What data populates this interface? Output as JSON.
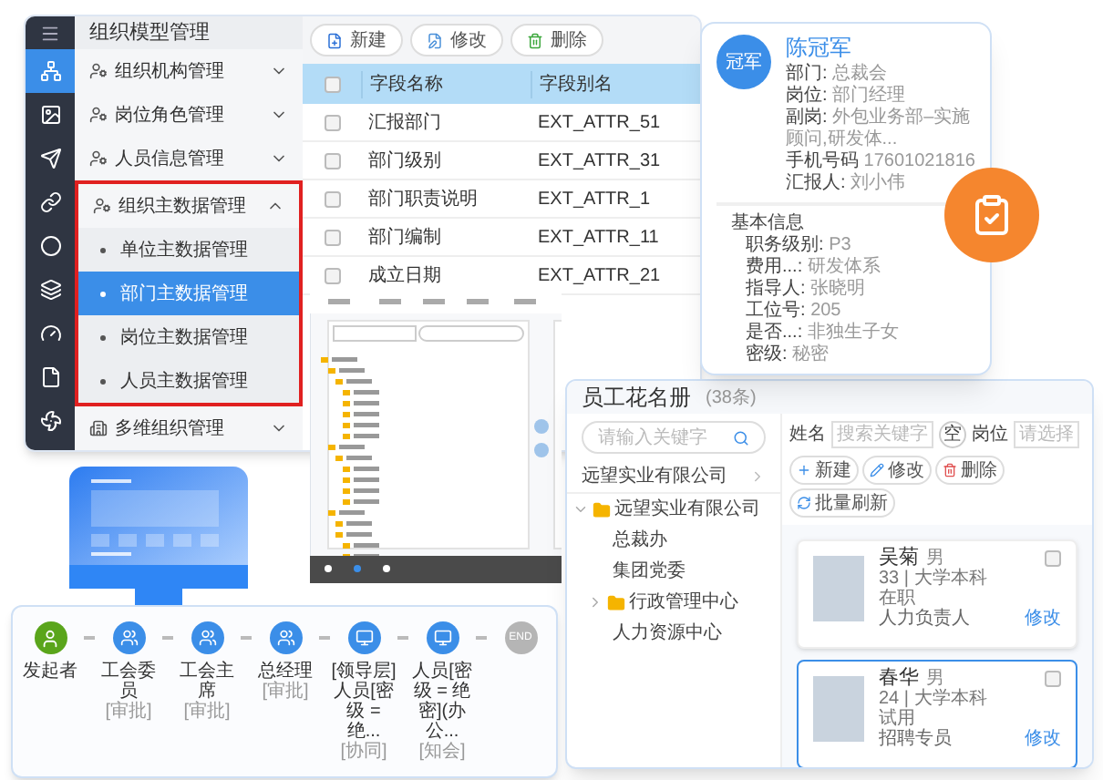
{
  "sidebar": {
    "icons": [
      {
        "kind": "sitemap",
        "selected": true
      },
      {
        "kind": "image",
        "selected": false
      },
      {
        "kind": "send",
        "selected": false
      },
      {
        "kind": "link",
        "selected": false
      },
      {
        "kind": "circle",
        "selected": false
      },
      {
        "kind": "layers",
        "selected": false
      },
      {
        "kind": "gauge",
        "selected": false
      },
      {
        "kind": "file",
        "selected": false
      },
      {
        "kind": "fan",
        "selected": false
      }
    ]
  },
  "menu": {
    "title": "组织模型管理",
    "items": [
      {
        "label": "组织机构管理",
        "kind": "user",
        "expanded": false,
        "highlighted": false
      },
      {
        "label": "岗位角色管理",
        "kind": "user",
        "expanded": false,
        "highlighted": false
      },
      {
        "label": "人员信息管理",
        "kind": "user",
        "expanded": false,
        "highlighted": false
      },
      {
        "label": "组织主数据管理",
        "kind": "user",
        "expanded": true,
        "highlighted": true,
        "children": [
          {
            "label": "单位主数据管理",
            "selected": false
          },
          {
            "label": "部门主数据管理",
            "selected": true
          },
          {
            "label": "岗位主数据管理",
            "selected": false
          },
          {
            "label": "人员主数据管理",
            "selected": false
          }
        ]
      },
      {
        "label": "多维组织管理",
        "kind": "building",
        "expanded": false,
        "highlighted": false
      }
    ]
  },
  "toolbar": [
    {
      "label": "新建",
      "kind": "new"
    },
    {
      "label": "修改",
      "kind": "edit"
    },
    {
      "label": "删除",
      "kind": "delete"
    }
  ],
  "table": {
    "columns": [
      "字段名称",
      "字段别名"
    ],
    "header_checked": false,
    "rows": [
      {
        "cells": [
          "汇报部门",
          "EXT_ATTR_51"
        ],
        "checked": false
      },
      {
        "cells": [
          "部门级别",
          "EXT_ATTR_31"
        ],
        "checked": false
      },
      {
        "cells": [
          "部门职责说明",
          "EXT_ATTR_1"
        ],
        "checked": false
      },
      {
        "cells": [
          "部门编制",
          "EXT_ATTR_11"
        ],
        "checked": false
      },
      {
        "cells": [
          "成立日期",
          "EXT_ATTR_21"
        ],
        "checked": false
      }
    ]
  },
  "profile": {
    "avatar": "冠军",
    "name": "陈冠军",
    "fields": [
      {
        "label": "部门:",
        "value": "总裁会"
      },
      {
        "label": "岗位:",
        "value": "部门经理"
      },
      {
        "label": "副岗:",
        "value": "外包业务部–实施顾问,研发体..."
      },
      {
        "label": "手机号码",
        "value": "17601021816"
      },
      {
        "label": "汇报人:",
        "value": "刘小伟"
      }
    ],
    "section": "基本信息",
    "details": [
      {
        "label": "职务级别:",
        "value": "P3"
      },
      {
        "label": "费用...:",
        "value": "研发体系"
      },
      {
        "label": "指导人:",
        "value": "张晓明"
      },
      {
        "label": "工位号:",
        "value": "205"
      },
      {
        "label": "是否...:",
        "value": "非独生子女"
      },
      {
        "label": "密级:",
        "value": "秘密"
      }
    ]
  },
  "roster": {
    "title": "员工花名册",
    "count": "(38条)",
    "search_placeholder": "请输入关键字",
    "company": "远望实业有限公司",
    "tree": [
      {
        "label": "远望实业有限公司",
        "folder": true,
        "expanded": true,
        "children": [
          {
            "label": "总裁办",
            "folder": false
          },
          {
            "label": "集团党委",
            "folder": false
          },
          {
            "label": "行政管理中心",
            "folder": true,
            "expanded": false
          },
          {
            "label": "人力资源中心",
            "folder": false
          }
        ]
      }
    ],
    "filters": [
      {
        "label": "姓名",
        "placeholder": "搜索关键字"
      },
      {
        "label": "岗位",
        "placeholder": "请选择"
      }
    ],
    "clear": "空",
    "buttons": [
      {
        "label": "新建",
        "kind": "add"
      },
      {
        "label": "修改",
        "kind": "edit"
      },
      {
        "label": "删除",
        "kind": "delete"
      },
      {
        "label": "批量刷新",
        "kind": "refresh"
      }
    ],
    "cards": [
      {
        "name": "吴菊",
        "gender": "男",
        "info": "33 | 大学本科",
        "status": "在职",
        "role": "人力负责人",
        "action": "修改",
        "selected": false,
        "checked": false
      },
      {
        "name": "春华",
        "gender": "男",
        "info": "24 | 大学本科",
        "status": "试用",
        "role": "招聘专员",
        "action": "修改",
        "selected": true,
        "checked": false
      }
    ]
  },
  "workflow": [
    {
      "label": "发起者",
      "kind": "start"
    },
    {
      "label": "工会委员",
      "note": "[审批]",
      "kind": "approve"
    },
    {
      "label": "工会主席",
      "note": "[审批]",
      "kind": "approve"
    },
    {
      "label": "总经理",
      "note": "[审批]",
      "kind": "approve"
    },
    {
      "label": "[领导层]人员[密级 = 绝...",
      "note": "[协同]",
      "kind": "screen"
    },
    {
      "label": "人员[密级 = 绝密](办公...",
      "note": "[知会]",
      "kind": "screen"
    },
    {
      "label": "END",
      "kind": "end"
    }
  ]
}
